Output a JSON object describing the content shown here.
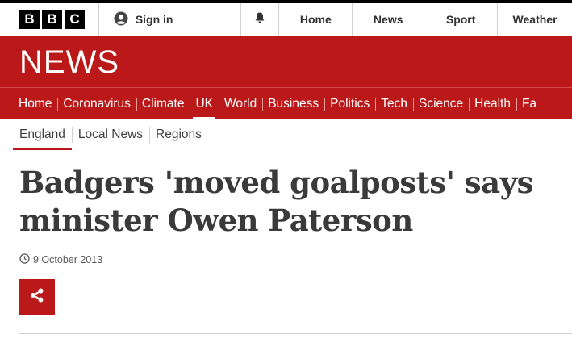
{
  "header": {
    "logo_letters": [
      "B",
      "B",
      "C"
    ],
    "signin_label": "Sign in",
    "links": [
      "Home",
      "News",
      "Sport",
      "Weather"
    ]
  },
  "masthead": {
    "title": "NEWS"
  },
  "nav": {
    "items": [
      "Home",
      "Coronavirus",
      "Climate",
      "UK",
      "World",
      "Business",
      "Politics",
      "Tech",
      "Science",
      "Health",
      "Fa"
    ],
    "active": "UK"
  },
  "subnav": {
    "items": [
      "England",
      "Local News",
      "Regions"
    ],
    "active": "England"
  },
  "article": {
    "headline": "Badgers 'moved goalposts' says minister Owen Paterson",
    "date": "9 October 2013"
  },
  "colors": {
    "brand_red": "#bb1919",
    "logo_black": "#000000"
  }
}
